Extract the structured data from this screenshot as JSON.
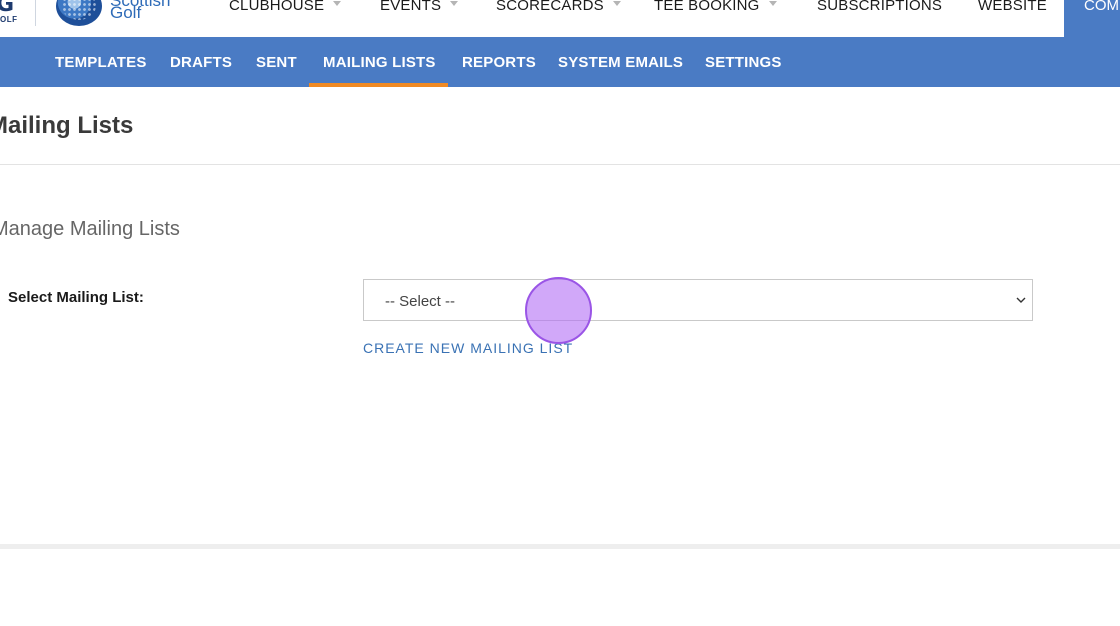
{
  "header": {
    "logo_letter": "G",
    "logo_small": "OLF",
    "logo_text_top": "Scottish",
    "logo_text": "Golf",
    "nav": [
      {
        "label": "CLUBHOUSE",
        "dropdown": true
      },
      {
        "label": "EVENTS",
        "dropdown": true
      },
      {
        "label": "SCORECARDS",
        "dropdown": true
      },
      {
        "label": "TEE BOOKING",
        "dropdown": true
      },
      {
        "label": "SUBSCRIPTIONS",
        "dropdown": false
      },
      {
        "label": "WEBSITE",
        "dropdown": false
      }
    ],
    "active_nav": "COM"
  },
  "subnav": {
    "tabs": [
      "TEMPLATES",
      "DRAFTS",
      "SENT",
      "MAILING LISTS",
      "REPORTS",
      "SYSTEM EMAILS",
      "SETTINGS"
    ],
    "active": "MAILING LISTS"
  },
  "page": {
    "title": "Mailing Lists",
    "section_title": "Manage Mailing Lists",
    "field_label": "Select Mailing List:",
    "select_value": "-- Select --",
    "create_link": "CREATE NEW MAILING LIST"
  },
  "colors": {
    "brand_blue": "#4a7bc4",
    "active_tab_underline": "#f08a24",
    "link": "#3a72b4"
  }
}
